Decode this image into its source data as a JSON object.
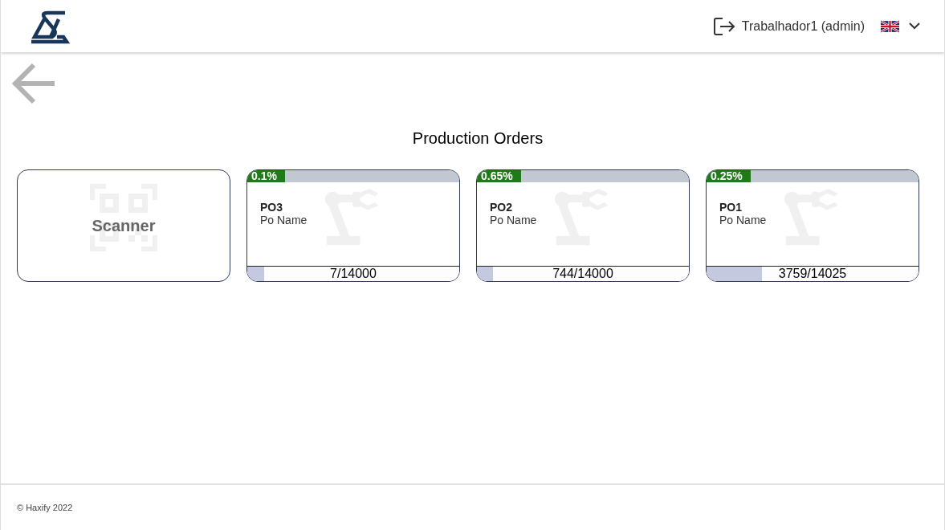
{
  "header": {
    "user": "Trabalhador1 (admin)"
  },
  "page": {
    "title": "Production Orders"
  },
  "scanner": {
    "label": "Scanner"
  },
  "orders": [
    {
      "code": "PO3",
      "name": "Po Name",
      "percent": "0.1%",
      "count": "7/14000",
      "level": 0.08
    },
    {
      "code": "PO2",
      "name": "Po Name",
      "percent": "0.65%",
      "count": "744/14000",
      "level": 0.075
    },
    {
      "code": "PO1",
      "name": "Po Name",
      "percent": "0.25%",
      "count": "3759/14025",
      "level": 0.26
    }
  ],
  "footer": {
    "copyright": "© Haxify 2022"
  }
}
